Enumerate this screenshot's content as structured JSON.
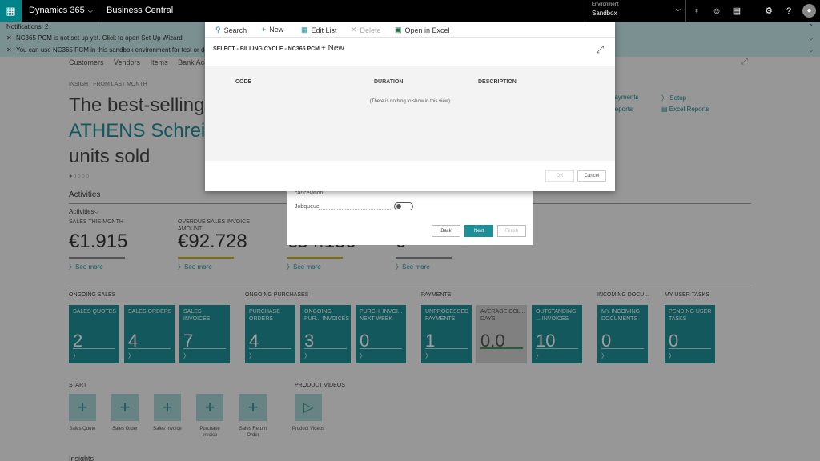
{
  "topbar": {
    "app_name": "Dynamics 365",
    "product": "Business Central",
    "environment_label": "Environment",
    "environment_value": "Sandbox",
    "icons": [
      "waffle-icon",
      "chevron-down-icon",
      "lightbulb-icon",
      "smiley-icon",
      "chat-icon",
      "gear-icon",
      "help-icon",
      "user-avatar-icon"
    ]
  },
  "notifications": {
    "header": "Notifications: 2",
    "items": [
      {
        "text": "NC365 PCM is not set up yet.",
        "action": "Click to open Set Up Wizard"
      },
      {
        "text": "You can use NC365 PCM in this sandbox environment for test or demo p"
      }
    ]
  },
  "nav": {
    "links": [
      "Customers",
      "Vendors",
      "Items",
      "Bank Acco"
    ]
  },
  "insight": {
    "label": "INSIGHT FROM LAST MONTH",
    "line1": "The best-selling",
    "line2": "ATHENS Schreib",
    "line3": "units sold",
    "dots": "●○○○○"
  },
  "activities": {
    "title": "Activities",
    "dropdown": "Activities",
    "kpis": [
      {
        "label": "SALES THIS MONTH",
        "value": "€1.915",
        "link": "See more"
      },
      {
        "label": "OVERDUE SALES INVOICE AMOUNT",
        "value": "€92.728",
        "link": "See more"
      },
      {
        "label": "",
        "value": "€54.150",
        "link": "See more"
      },
      {
        "label": "",
        "value": "0",
        "link": "See more"
      }
    ]
  },
  "right_links": {
    "payments": "Payments",
    "reports": "Reports",
    "setup": "Setup",
    "excel_reports": "Excel Reports"
  },
  "groups": {
    "ongoing_sales": "ONGOING SALES",
    "ongoing_purchases": "ONGOING PURCHASES",
    "payments": "PAYMENTS",
    "incoming_docs": "INCOMING DOCU...",
    "user_tasks": "MY USER TASKS"
  },
  "tiles": [
    {
      "label": "SALES QUOTES",
      "value": "2"
    },
    {
      "label": "SALES ORDERS",
      "value": "4"
    },
    {
      "label": "SALES INVOICES",
      "value": "7"
    },
    {
      "label": "PURCHASE ORDERS",
      "value": "4"
    },
    {
      "label": "ONGOING PUR... INVOICES",
      "value": "3"
    },
    {
      "label": "PURCH. INVOI... NEXT WEEK",
      "value": "0"
    },
    {
      "label": "UNPROCESSED PAYMENTS",
      "value": "1"
    },
    {
      "label": "AVERAGE COL... DAYS",
      "value": "0,0"
    },
    {
      "label": "OUTSTANDING ... INVOICES",
      "value": "10"
    },
    {
      "label": "MY INCOMING DOCUMENTS",
      "value": "0"
    },
    {
      "label": "PENDING USER TASKS",
      "value": "0"
    }
  ],
  "start": {
    "title": "START",
    "actions": [
      "Sales Quote",
      "Sales Order",
      "Sales Invoice",
      "Purchase Invoice",
      "Sales Return Order"
    ]
  },
  "videos": {
    "title": "PRODUCT VIDEOS",
    "label": "Product Videos"
  },
  "insights_title": "Insights",
  "wizard": {
    "text": "cancelation",
    "jobqueue": "Jobqueue",
    "back": "Back",
    "next": "Next",
    "finish": "Finish"
  },
  "modal": {
    "toolbar": {
      "search": "Search",
      "new": "New",
      "edit_list": "Edit List",
      "delete": "Delete",
      "open_excel": "Open in Excel"
    },
    "title": "SELECT - BILLING CYCLE - NC365 PCM",
    "new": "+ New",
    "columns": [
      "CODE",
      "DURATION",
      "DESCRIPTION"
    ],
    "empty": "(There is nothing to show in this view)",
    "ok": "OK",
    "cancel": "Cancel"
  },
  "colors": {
    "teal": "#1e8f96",
    "notif_bg": "#c7e8ea",
    "topbar": "#000000"
  }
}
